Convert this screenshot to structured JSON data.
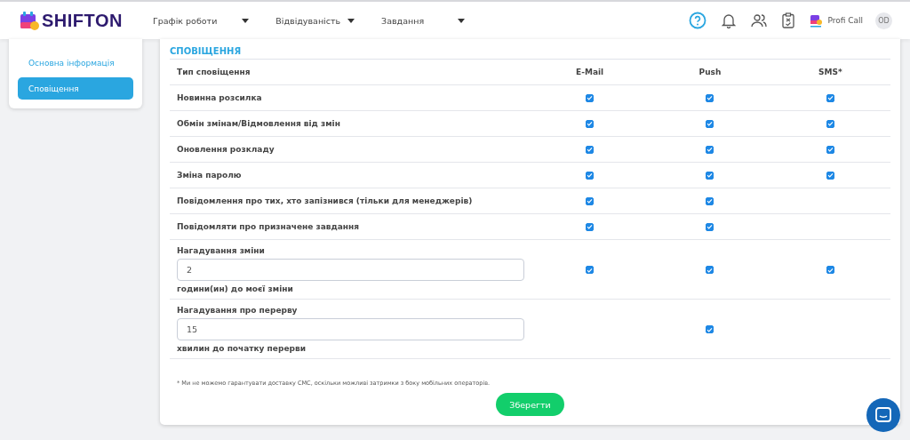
{
  "header": {
    "logo": "SHIFTON",
    "menu": [
      {
        "label": "Графік роботи"
      },
      {
        "label": "Відвідуваність"
      },
      {
        "label": "Завдання"
      }
    ],
    "company": "Profi Call",
    "avatar": "OD"
  },
  "sidebar": {
    "items": [
      {
        "label": "Основна інформація",
        "selected": false
      },
      {
        "label": "Сповіщення",
        "selected": true
      }
    ]
  },
  "section_title": "СПОВІЩЕННЯ",
  "table": {
    "columns": [
      "Тип сповіщення",
      "E-Mail",
      "Push",
      "SMS*"
    ],
    "rows": [
      {
        "kind": "plain",
        "label": "Новинна розсилка",
        "email": {
          "checked": true
        },
        "push": {
          "checked": true
        },
        "sms": {
          "checked": true
        }
      },
      {
        "kind": "plain",
        "label": "Обмін змінам/Відмовлення від змін",
        "email": {
          "checked": true
        },
        "push": {
          "checked": true
        },
        "sms": {
          "checked": true
        }
      },
      {
        "kind": "plain",
        "label": "Оновлення розкладу",
        "email": {
          "checked": true
        },
        "push": {
          "checked": true
        },
        "sms": {
          "checked": true
        }
      },
      {
        "kind": "plain",
        "label": "Зміна паролю",
        "email": {
          "checked": true
        },
        "push": {
          "checked": true
        },
        "sms": {
          "checked": true
        }
      },
      {
        "kind": "plain",
        "label": "Повідомлення про тих, хто запізнився (тільки для менеджерів)",
        "email": {
          "checked": true
        },
        "push": {
          "checked": true
        }
      },
      {
        "kind": "plain",
        "label": "Повідомляти про призначене завдання",
        "email": {
          "checked": true
        },
        "push": {
          "checked": true
        }
      },
      {
        "kind": "input",
        "label": "Нагадування зміни",
        "value": "2",
        "unit": "години(ин) до моєї зміни",
        "email": {
          "checked": true
        },
        "push": {
          "checked": true
        },
        "sms": {
          "checked": true
        }
      },
      {
        "kind": "input",
        "label": "Нагадування про перерву",
        "value": "15",
        "unit": "хвилин до початку перерви",
        "push": {
          "checked": true
        }
      }
    ]
  },
  "footnote": "* Ми не можемо гарантувати доставку СМС, оскільки можливі затримки з боку мобільних операторів.",
  "save_button": "Зберегти"
}
